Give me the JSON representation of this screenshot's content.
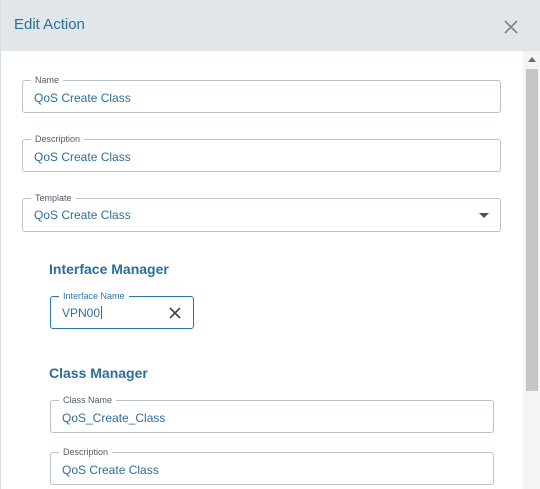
{
  "dialog": {
    "title": "Edit Action"
  },
  "form": {
    "name": {
      "label": "Name",
      "value": "QoS Create Class"
    },
    "description": {
      "label": "Description",
      "value": "QoS Create Class"
    },
    "template": {
      "label": "Template",
      "value": "QoS Create Class"
    }
  },
  "interface_manager": {
    "title": "Interface Manager",
    "interface_name": {
      "label": "Interface Name",
      "value": "VPN00"
    }
  },
  "class_manager": {
    "title": "Class Manager",
    "class_name": {
      "label": "Class Name",
      "value": "QoS_Create_Class"
    },
    "description": {
      "label": "Description",
      "value": "QoS Create Class"
    }
  },
  "icons": {
    "close": "close-icon",
    "dropdown": "chevron-down-icon",
    "clear": "clear-icon"
  },
  "colors": {
    "accent": "#2a6f9a",
    "header_bg": "#e1e6ea",
    "border": "#b9c2c9",
    "focus_border": "#2b78a8"
  }
}
